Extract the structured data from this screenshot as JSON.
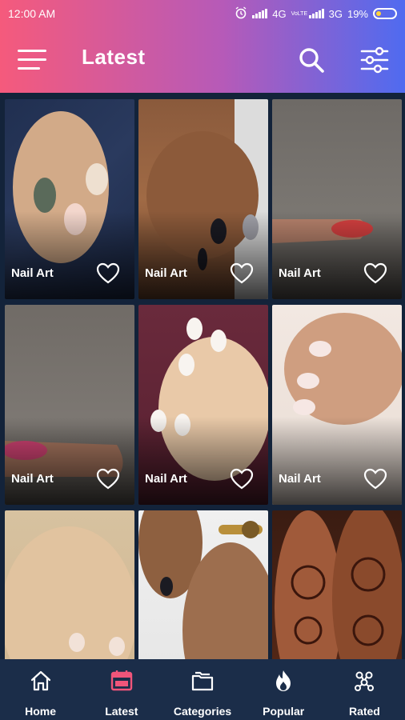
{
  "status_bar": {
    "time": "12:00 AM",
    "network_1": "4G",
    "carrier_tag": "VoLTE",
    "network_2": "3G",
    "battery": "19%"
  },
  "header": {
    "title": "Latest",
    "menu_icon": "hamburger-menu-icon",
    "search_icon": "search-icon",
    "filter_icon": "sliders-icon"
  },
  "grid": {
    "items": [
      {
        "label": "Nail Art"
      },
      {
        "label": "Nail Art"
      },
      {
        "label": "Nail Art"
      },
      {
        "label": "Nail Art"
      },
      {
        "label": "Nail Art"
      },
      {
        "label": "Nail Art"
      },
      {
        "label": ""
      },
      {
        "label": ""
      },
      {
        "label": ""
      }
    ]
  },
  "bottom_nav": {
    "items": [
      {
        "label": "Home",
        "icon": "home-icon",
        "active": false
      },
      {
        "label": "Latest",
        "icon": "latest-icon",
        "active": true
      },
      {
        "label": "Categories",
        "icon": "folders-icon",
        "active": false
      },
      {
        "label": "Popular",
        "icon": "flame-icon",
        "active": false
      },
      {
        "label": "Rated",
        "icon": "rated-icon",
        "active": false
      }
    ]
  },
  "colors": {
    "gradient_start": "#f55a7c",
    "gradient_end": "#4f6bf0",
    "background": "#13233a",
    "nav_background": "#1b2d49",
    "active_icon": "#f0557a"
  }
}
